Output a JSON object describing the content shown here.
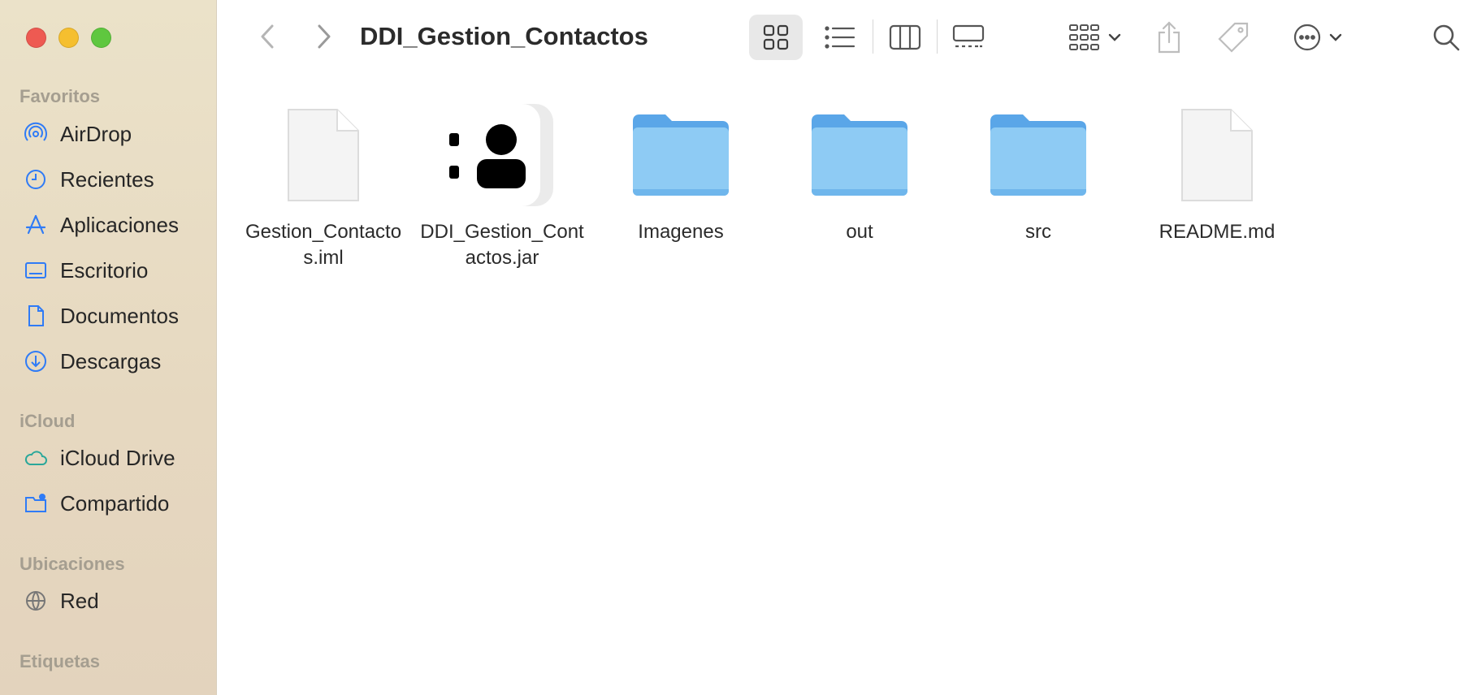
{
  "window": {
    "title": "DDI_Gestion_Contactos"
  },
  "sidebar": {
    "sections": [
      {
        "title": "Favoritos"
      },
      {
        "title": "iCloud"
      },
      {
        "title": "Ubicaciones"
      },
      {
        "title": "Etiquetas"
      }
    ],
    "items": [
      {
        "label": "AirDrop",
        "icon": "airdrop-icon"
      },
      {
        "label": "Recientes",
        "icon": "clock-icon"
      },
      {
        "label": "Aplicaciones",
        "icon": "applications-icon"
      },
      {
        "label": "Escritorio",
        "icon": "desktop-icon"
      },
      {
        "label": "Documentos",
        "icon": "document-icon"
      },
      {
        "label": "Descargas",
        "icon": "download-icon"
      },
      {
        "label": "iCloud Drive",
        "icon": "cloud-icon"
      },
      {
        "label": "Compartido",
        "icon": "shared-folder-icon"
      },
      {
        "label": "Red",
        "icon": "globe-icon"
      }
    ]
  },
  "files": [
    {
      "name": "Gestion_Contactos.iml",
      "kind": "document"
    },
    {
      "name": "DDI_Gestion_Contactos.jar",
      "kind": "jar"
    },
    {
      "name": "Imagenes",
      "kind": "folder"
    },
    {
      "name": "out",
      "kind": "folder"
    },
    {
      "name": "src",
      "kind": "folder"
    },
    {
      "name": "README.md",
      "kind": "document"
    }
  ],
  "colors": {
    "accent": "#2f7bf6",
    "folder": "#8ecbf4",
    "folder_tab": "#5aa6e8"
  }
}
